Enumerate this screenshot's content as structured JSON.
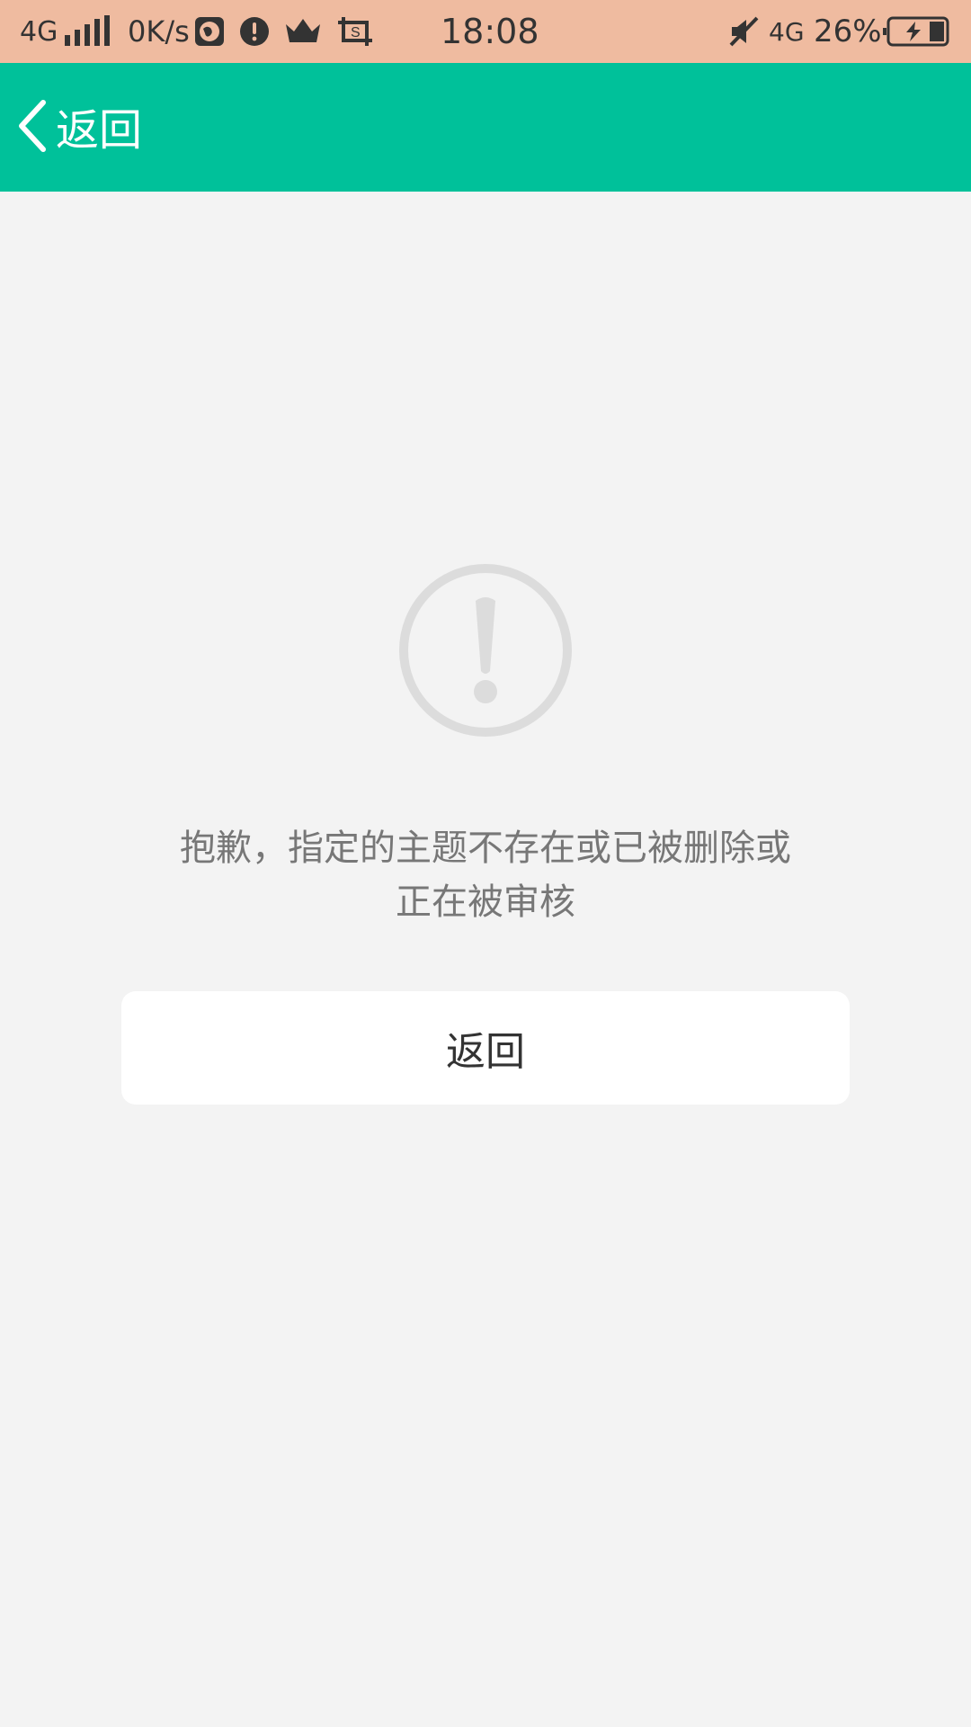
{
  "status_bar": {
    "network": "4G",
    "speed": "0K/s",
    "time": "18:08",
    "network_right": "4G",
    "battery": "26%",
    "icons": [
      "signal-bars-icon",
      "globe-icon",
      "alert-circle-icon",
      "crown-icon",
      "screenshot-icon",
      "mute-icon",
      "battery-charging-icon"
    ]
  },
  "app_bar": {
    "back_label": "返回",
    "background_color": "#00c19a"
  },
  "error": {
    "icon": "exclamation-circle-icon",
    "message_line1": "抱歉，指定的主题不存在或已被删除或",
    "message_line2": "正在被审核"
  },
  "actions": {
    "return_label": "返回"
  }
}
